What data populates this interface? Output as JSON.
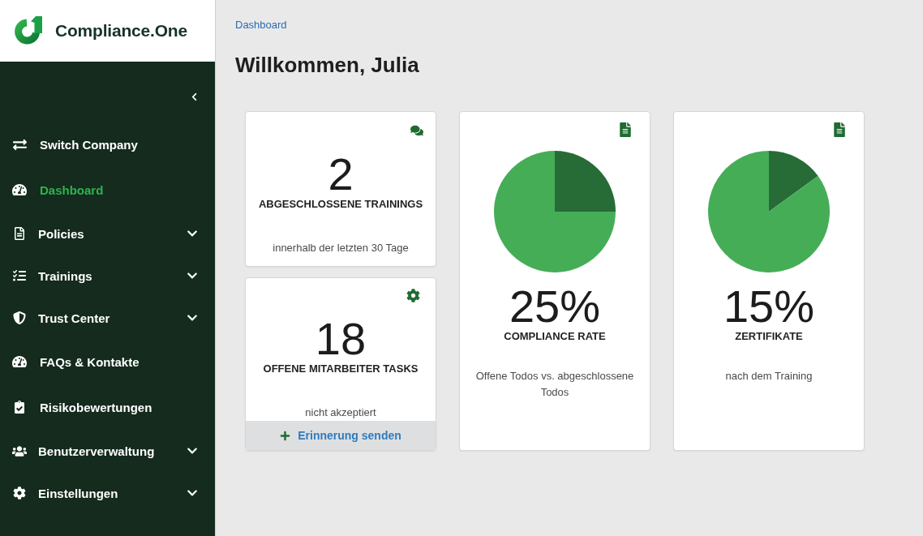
{
  "sidebar": {
    "logo_text": "Compliance.One",
    "items": [
      {
        "label": "Switch Company",
        "kind": "link",
        "selected": false
      },
      {
        "label": "Dashboard",
        "kind": "link",
        "selected": true
      },
      {
        "label": "Policies",
        "kind": "group",
        "selected": false
      },
      {
        "label": "Trainings",
        "kind": "group",
        "selected": false
      },
      {
        "label": "Trust Center",
        "kind": "group",
        "selected": false
      },
      {
        "label": "FAQs & Kontakte",
        "kind": "link",
        "selected": false
      },
      {
        "label": "Risikobewertungen",
        "kind": "link",
        "selected": false
      },
      {
        "label": "Benutzerverwaltung",
        "kind": "group",
        "selected": false
      },
      {
        "label": "Einstellungen",
        "kind": "group",
        "selected": false
      }
    ]
  },
  "breadcrumb": [
    "Dashboard"
  ],
  "title": "Willkommen, Julia",
  "cards": [
    {
      "kind": "stat",
      "value": "2",
      "title": "ABGESCHLOSSENE TRAININGS",
      "subtitle": "innerhalb der letzten 30 Tage"
    },
    {
      "kind": "stat",
      "value": "18",
      "title": "OFFENE MITARBEITER TASKS",
      "subtitle": "nicht akzeptiert",
      "action": {
        "label": "Erinnerung senden"
      }
    },
    {
      "kind": "chart",
      "value": "25%",
      "title": "COMPLIANCE RATE",
      "subtitle": "Offene Todos vs. abgeschlossene Todos",
      "chart_data": {
        "type": "pie",
        "values": [
          25,
          75
        ]
      }
    },
    {
      "kind": "chart",
      "value": "15%",
      "title": "ZERTIFIKATE",
      "subtitle": "nach dem Training",
      "chart_data": {
        "type": "pie",
        "values": [
          15,
          85
        ]
      }
    }
  ]
}
